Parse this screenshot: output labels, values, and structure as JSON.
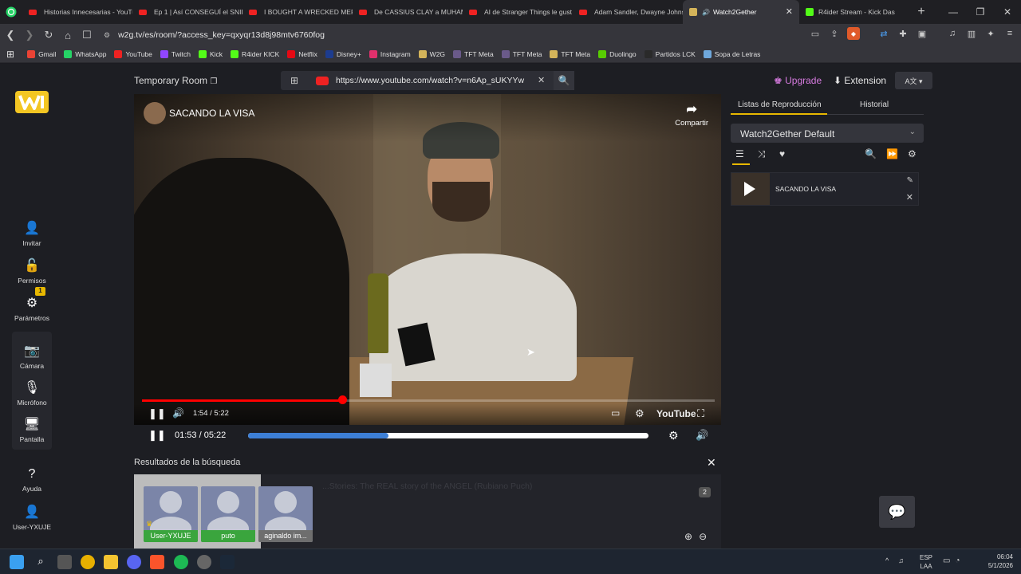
{
  "browser": {
    "tabs": [
      {
        "label": "Historias Innecesarias - YouTu",
        "type": "youtube"
      },
      {
        "label": "Ep 1 | Así CONSEGUÍ el SNIP",
        "type": "youtube"
      },
      {
        "label": "I BOUGHT A WRECKED MERC",
        "type": "youtube"
      },
      {
        "label": "De CASSIUS CLAY a MUHAM",
        "type": "youtube"
      },
      {
        "label": "AI de Stranger Things le gust",
        "type": "youtube"
      },
      {
        "label": "Adam Sandler, Dwayne Johns",
        "type": "youtube"
      },
      {
        "label": "Watch2Gether",
        "type": "w2g"
      },
      {
        "label": "R4ider Stream - Kick Das",
        "type": "kick"
      }
    ],
    "url": "w2g.tv/es/room/?access_key=qxyqr13d8j98mtv6760fog",
    "bookmarks": [
      "Gmail",
      "WhatsApp",
      "YouTube",
      "Twitch",
      "Kick",
      "R4ider KICK",
      "Netflix",
      "Disney+",
      "Instagram",
      "W2G",
      "TFT Meta",
      "TFT Meta",
      "TFT Meta",
      "Duolingo",
      "Partidos LCK",
      "Sopa de Letras"
    ],
    "bookmark_colors": [
      "#ea4335",
      "#25d366",
      "#e22",
      "#9146ff",
      "#53fc18",
      "#53fc18",
      "#e50914",
      "#1d3c8f",
      "#e1306c",
      "#d4b45a",
      "#6a5a8a",
      "#6a5a8a",
      "#d4b45a",
      "#58cc02",
      "#2a2a2a",
      "#6fa8dc"
    ]
  },
  "sidebar": {
    "items": [
      {
        "label": "Invitar",
        "icon": "add-user-icon"
      },
      {
        "label": "Permisos",
        "icon": "unlock-icon"
      },
      {
        "label": "Parámetros",
        "icon": "gear-icon",
        "badge": "1"
      },
      {
        "label": "Cámara",
        "icon": "camera-icon"
      },
      {
        "label": "Micrófono",
        "icon": "mic-icon"
      },
      {
        "label": "Pantalla",
        "icon": "screen-icon"
      },
      {
        "label": "Ayuda",
        "icon": "help-icon"
      },
      {
        "label": "User-YXUJE",
        "icon": "user-icon"
      }
    ]
  },
  "room": {
    "title": "Temporary Room",
    "search_value": "https://www.youtube.com/watch?v=n6Ap_sUKYYw",
    "upgrade": "Upgrade",
    "extension": "Extension"
  },
  "video": {
    "title": "SACANDO LA VISA",
    "share": "Compartir",
    "yt_time": "1:54 / 5:22",
    "yt_brand": "YouTube",
    "yt_progress": 0.35,
    "w2g_time": "01:53 / 05:22",
    "w2g_progress": 0.35
  },
  "results": {
    "title": "Resultados de la búsqueda",
    "item_text": "...Stories: The REAL story of the ANGEL (Rubiano Puch)",
    "count": "2",
    "users": [
      {
        "name": "User-YXUJE",
        "host": true
      },
      {
        "name": "puto",
        "host": false
      },
      {
        "name": "aginaldo im...",
        "host": false
      }
    ]
  },
  "playlist": {
    "tab_playlists": "Listas de Reproducción",
    "tab_history": "Historial",
    "selected": "Watch2Gether Default",
    "items": [
      {
        "title": "SACANDO LA VISA"
      }
    ]
  },
  "taskbar": {
    "lang": "ESP",
    "lang2": "LAA",
    "time": "06:04",
    "date": "5/1/2026"
  }
}
